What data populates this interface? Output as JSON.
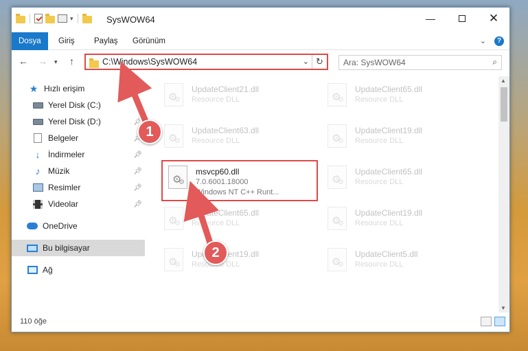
{
  "window": {
    "title": "SysWOW64"
  },
  "ribbon": {
    "tabs": [
      "Dosya",
      "Giriş",
      "Paylaş",
      "Görünüm"
    ]
  },
  "address": {
    "path": "C:\\Windows\\SysWOW64"
  },
  "search": {
    "placeholder": "Ara: SysWOW64"
  },
  "sidebar": {
    "items": [
      {
        "label": "Hızlı erişim",
        "icon": "star-icon"
      },
      {
        "label": "Yerel Disk (C:)",
        "icon": "drive-icon"
      },
      {
        "label": "Yerel Disk (D:)",
        "icon": "drive-icon"
      },
      {
        "label": "Belgeler",
        "icon": "document-icon"
      },
      {
        "label": "İndirmeler",
        "icon": "download-icon"
      },
      {
        "label": "Müzik",
        "icon": "music-icon"
      },
      {
        "label": "Resimler",
        "icon": "pictures-icon"
      },
      {
        "label": "Videolar",
        "icon": "video-icon"
      },
      {
        "label": "OneDrive",
        "icon": "cloud-icon"
      },
      {
        "label": "Bu bilgisayar",
        "icon": "computer-icon"
      },
      {
        "label": "Ağ",
        "icon": "network-icon"
      }
    ]
  },
  "files": [
    {
      "name": "UpdateClient21.dll",
      "desc": "Resource DLL"
    },
    {
      "name": "UpdateClient65.dll",
      "desc": "Resource DLL"
    },
    {
      "name": "UpdateClient63.dll",
      "desc": "Resource DLL"
    },
    {
      "name": "UpdateClient19.dll",
      "desc": "Resource DLL"
    },
    {
      "name": "msvcp60.dll",
      "desc": "7.0.6001.18000",
      "desc2": "Windows NT C++ Runt..."
    },
    {
      "name": "UpdateClient65.dll",
      "desc": "Resource DLL"
    },
    {
      "name": "UpdateClient65.dll",
      "desc": "Resource DLL"
    },
    {
      "name": "UpdateClient19.dll",
      "desc": "Resource DLL"
    },
    {
      "name": "UpdateClient19.dll",
      "desc": "Resource DLL"
    },
    {
      "name": "UpdateClient5.dll",
      "desc": "Resource DLL"
    }
  ],
  "status": {
    "count": "110 öğe"
  },
  "annotations": {
    "badge1": "1",
    "badge2": "2"
  },
  "colors": {
    "accent": "#1979ca",
    "highlight": "#e04848",
    "arrow": "#e25a5a"
  }
}
